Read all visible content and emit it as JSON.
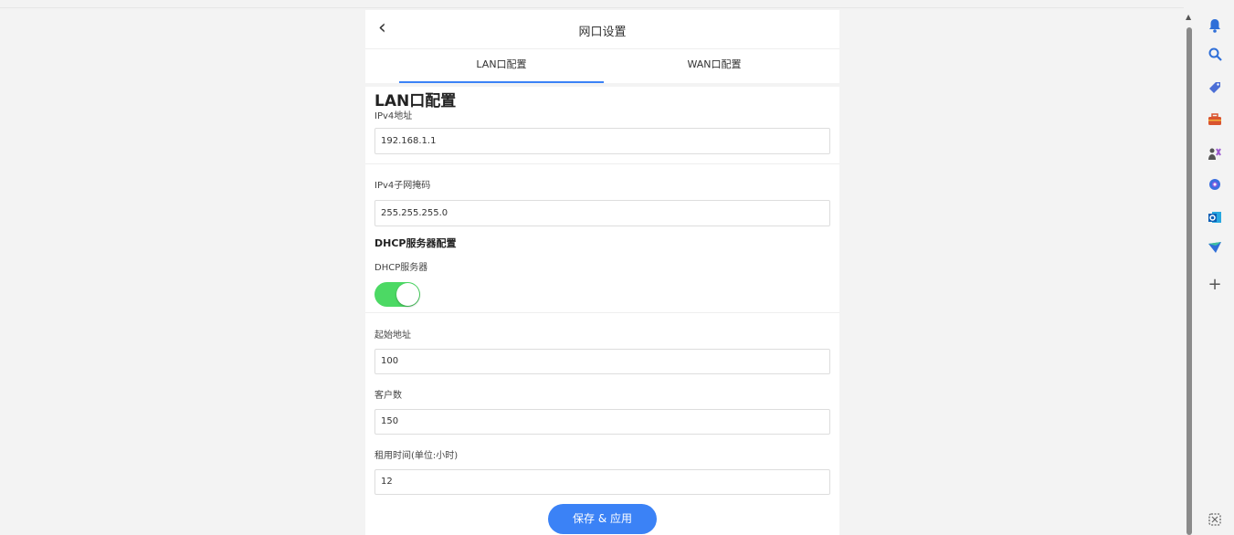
{
  "header": {
    "title": "网口设置",
    "back_glyph": "‹"
  },
  "tabs": [
    {
      "label": "LAN口配置"
    },
    {
      "label": "WAN口配置"
    }
  ],
  "lan": {
    "section_title": "LAN口配置",
    "ipv4_label": "IPv4地址",
    "ipv4_value": "192.168.1.1",
    "mask_label": "IPv4子网掩码",
    "mask_value": "255.255.255.0"
  },
  "dhcp": {
    "section_title": "DHCP服务器配置",
    "toggle_label": "DHCP服务器",
    "enabled": true,
    "start_label": "起始地址",
    "start_value": "100",
    "clients_label": "客户数",
    "clients_value": "150",
    "lease_label": "租用时间(单位:小时)",
    "lease_value": "12"
  },
  "actions": {
    "save_label": "保存 & 应用"
  },
  "colors": {
    "accent": "#3b82f6",
    "toggle_on": "#4cd964",
    "background": "#f3f3f3"
  },
  "edge_icons": [
    "bell-icon",
    "search-icon",
    "tag-icon",
    "toolbox-icon",
    "chess-icon",
    "copilot-icon",
    "outlook-icon",
    "send-icon",
    "plus-icon",
    "screenshot-icon"
  ]
}
